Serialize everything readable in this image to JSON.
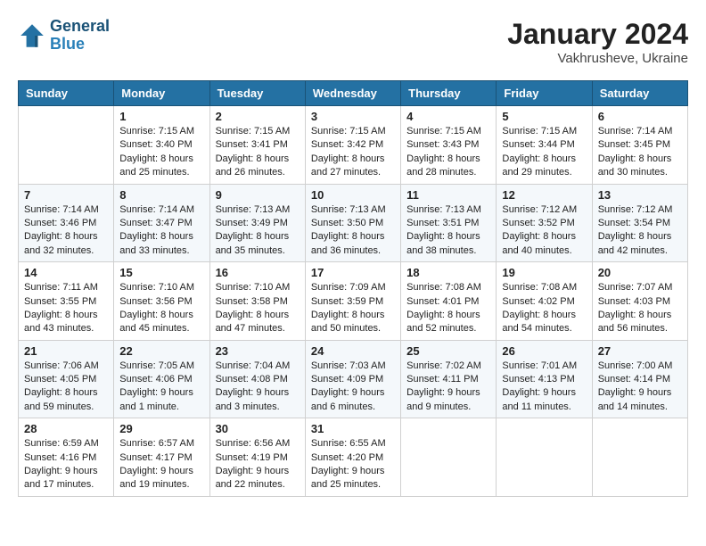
{
  "header": {
    "logo_line1": "General",
    "logo_line2": "Blue",
    "month": "January 2024",
    "location": "Vakhrusheve, Ukraine"
  },
  "weekdays": [
    "Sunday",
    "Monday",
    "Tuesday",
    "Wednesday",
    "Thursday",
    "Friday",
    "Saturday"
  ],
  "weeks": [
    [
      {
        "day": "",
        "sunrise": "",
        "sunset": "",
        "daylight": ""
      },
      {
        "day": "1",
        "sunrise": "Sunrise: 7:15 AM",
        "sunset": "Sunset: 3:40 PM",
        "daylight": "Daylight: 8 hours and 25 minutes."
      },
      {
        "day": "2",
        "sunrise": "Sunrise: 7:15 AM",
        "sunset": "Sunset: 3:41 PM",
        "daylight": "Daylight: 8 hours and 26 minutes."
      },
      {
        "day": "3",
        "sunrise": "Sunrise: 7:15 AM",
        "sunset": "Sunset: 3:42 PM",
        "daylight": "Daylight: 8 hours and 27 minutes."
      },
      {
        "day": "4",
        "sunrise": "Sunrise: 7:15 AM",
        "sunset": "Sunset: 3:43 PM",
        "daylight": "Daylight: 8 hours and 28 minutes."
      },
      {
        "day": "5",
        "sunrise": "Sunrise: 7:15 AM",
        "sunset": "Sunset: 3:44 PM",
        "daylight": "Daylight: 8 hours and 29 minutes."
      },
      {
        "day": "6",
        "sunrise": "Sunrise: 7:14 AM",
        "sunset": "Sunset: 3:45 PM",
        "daylight": "Daylight: 8 hours and 30 minutes."
      }
    ],
    [
      {
        "day": "7",
        "sunrise": "Sunrise: 7:14 AM",
        "sunset": "Sunset: 3:46 PM",
        "daylight": "Daylight: 8 hours and 32 minutes."
      },
      {
        "day": "8",
        "sunrise": "Sunrise: 7:14 AM",
        "sunset": "Sunset: 3:47 PM",
        "daylight": "Daylight: 8 hours and 33 minutes."
      },
      {
        "day": "9",
        "sunrise": "Sunrise: 7:13 AM",
        "sunset": "Sunset: 3:49 PM",
        "daylight": "Daylight: 8 hours and 35 minutes."
      },
      {
        "day": "10",
        "sunrise": "Sunrise: 7:13 AM",
        "sunset": "Sunset: 3:50 PM",
        "daylight": "Daylight: 8 hours and 36 minutes."
      },
      {
        "day": "11",
        "sunrise": "Sunrise: 7:13 AM",
        "sunset": "Sunset: 3:51 PM",
        "daylight": "Daylight: 8 hours and 38 minutes."
      },
      {
        "day": "12",
        "sunrise": "Sunrise: 7:12 AM",
        "sunset": "Sunset: 3:52 PM",
        "daylight": "Daylight: 8 hours and 40 minutes."
      },
      {
        "day": "13",
        "sunrise": "Sunrise: 7:12 AM",
        "sunset": "Sunset: 3:54 PM",
        "daylight": "Daylight: 8 hours and 42 minutes."
      }
    ],
    [
      {
        "day": "14",
        "sunrise": "Sunrise: 7:11 AM",
        "sunset": "Sunset: 3:55 PM",
        "daylight": "Daylight: 8 hours and 43 minutes."
      },
      {
        "day": "15",
        "sunrise": "Sunrise: 7:10 AM",
        "sunset": "Sunset: 3:56 PM",
        "daylight": "Daylight: 8 hours and 45 minutes."
      },
      {
        "day": "16",
        "sunrise": "Sunrise: 7:10 AM",
        "sunset": "Sunset: 3:58 PM",
        "daylight": "Daylight: 8 hours and 47 minutes."
      },
      {
        "day": "17",
        "sunrise": "Sunrise: 7:09 AM",
        "sunset": "Sunset: 3:59 PM",
        "daylight": "Daylight: 8 hours and 50 minutes."
      },
      {
        "day": "18",
        "sunrise": "Sunrise: 7:08 AM",
        "sunset": "Sunset: 4:01 PM",
        "daylight": "Daylight: 8 hours and 52 minutes."
      },
      {
        "day": "19",
        "sunrise": "Sunrise: 7:08 AM",
        "sunset": "Sunset: 4:02 PM",
        "daylight": "Daylight: 8 hours and 54 minutes."
      },
      {
        "day": "20",
        "sunrise": "Sunrise: 7:07 AM",
        "sunset": "Sunset: 4:03 PM",
        "daylight": "Daylight: 8 hours and 56 minutes."
      }
    ],
    [
      {
        "day": "21",
        "sunrise": "Sunrise: 7:06 AM",
        "sunset": "Sunset: 4:05 PM",
        "daylight": "Daylight: 8 hours and 59 minutes."
      },
      {
        "day": "22",
        "sunrise": "Sunrise: 7:05 AM",
        "sunset": "Sunset: 4:06 PM",
        "daylight": "Daylight: 9 hours and 1 minute."
      },
      {
        "day": "23",
        "sunrise": "Sunrise: 7:04 AM",
        "sunset": "Sunset: 4:08 PM",
        "daylight": "Daylight: 9 hours and 3 minutes."
      },
      {
        "day": "24",
        "sunrise": "Sunrise: 7:03 AM",
        "sunset": "Sunset: 4:09 PM",
        "daylight": "Daylight: 9 hours and 6 minutes."
      },
      {
        "day": "25",
        "sunrise": "Sunrise: 7:02 AM",
        "sunset": "Sunset: 4:11 PM",
        "daylight": "Daylight: 9 hours and 9 minutes."
      },
      {
        "day": "26",
        "sunrise": "Sunrise: 7:01 AM",
        "sunset": "Sunset: 4:13 PM",
        "daylight": "Daylight: 9 hours and 11 minutes."
      },
      {
        "day": "27",
        "sunrise": "Sunrise: 7:00 AM",
        "sunset": "Sunset: 4:14 PM",
        "daylight": "Daylight: 9 hours and 14 minutes."
      }
    ],
    [
      {
        "day": "28",
        "sunrise": "Sunrise: 6:59 AM",
        "sunset": "Sunset: 4:16 PM",
        "daylight": "Daylight: 9 hours and 17 minutes."
      },
      {
        "day": "29",
        "sunrise": "Sunrise: 6:57 AM",
        "sunset": "Sunset: 4:17 PM",
        "daylight": "Daylight: 9 hours and 19 minutes."
      },
      {
        "day": "30",
        "sunrise": "Sunrise: 6:56 AM",
        "sunset": "Sunset: 4:19 PM",
        "daylight": "Daylight: 9 hours and 22 minutes."
      },
      {
        "day": "31",
        "sunrise": "Sunrise: 6:55 AM",
        "sunset": "Sunset: 4:20 PM",
        "daylight": "Daylight: 9 hours and 25 minutes."
      },
      {
        "day": "",
        "sunrise": "",
        "sunset": "",
        "daylight": ""
      },
      {
        "day": "",
        "sunrise": "",
        "sunset": "",
        "daylight": ""
      },
      {
        "day": "",
        "sunrise": "",
        "sunset": "",
        "daylight": ""
      }
    ]
  ]
}
